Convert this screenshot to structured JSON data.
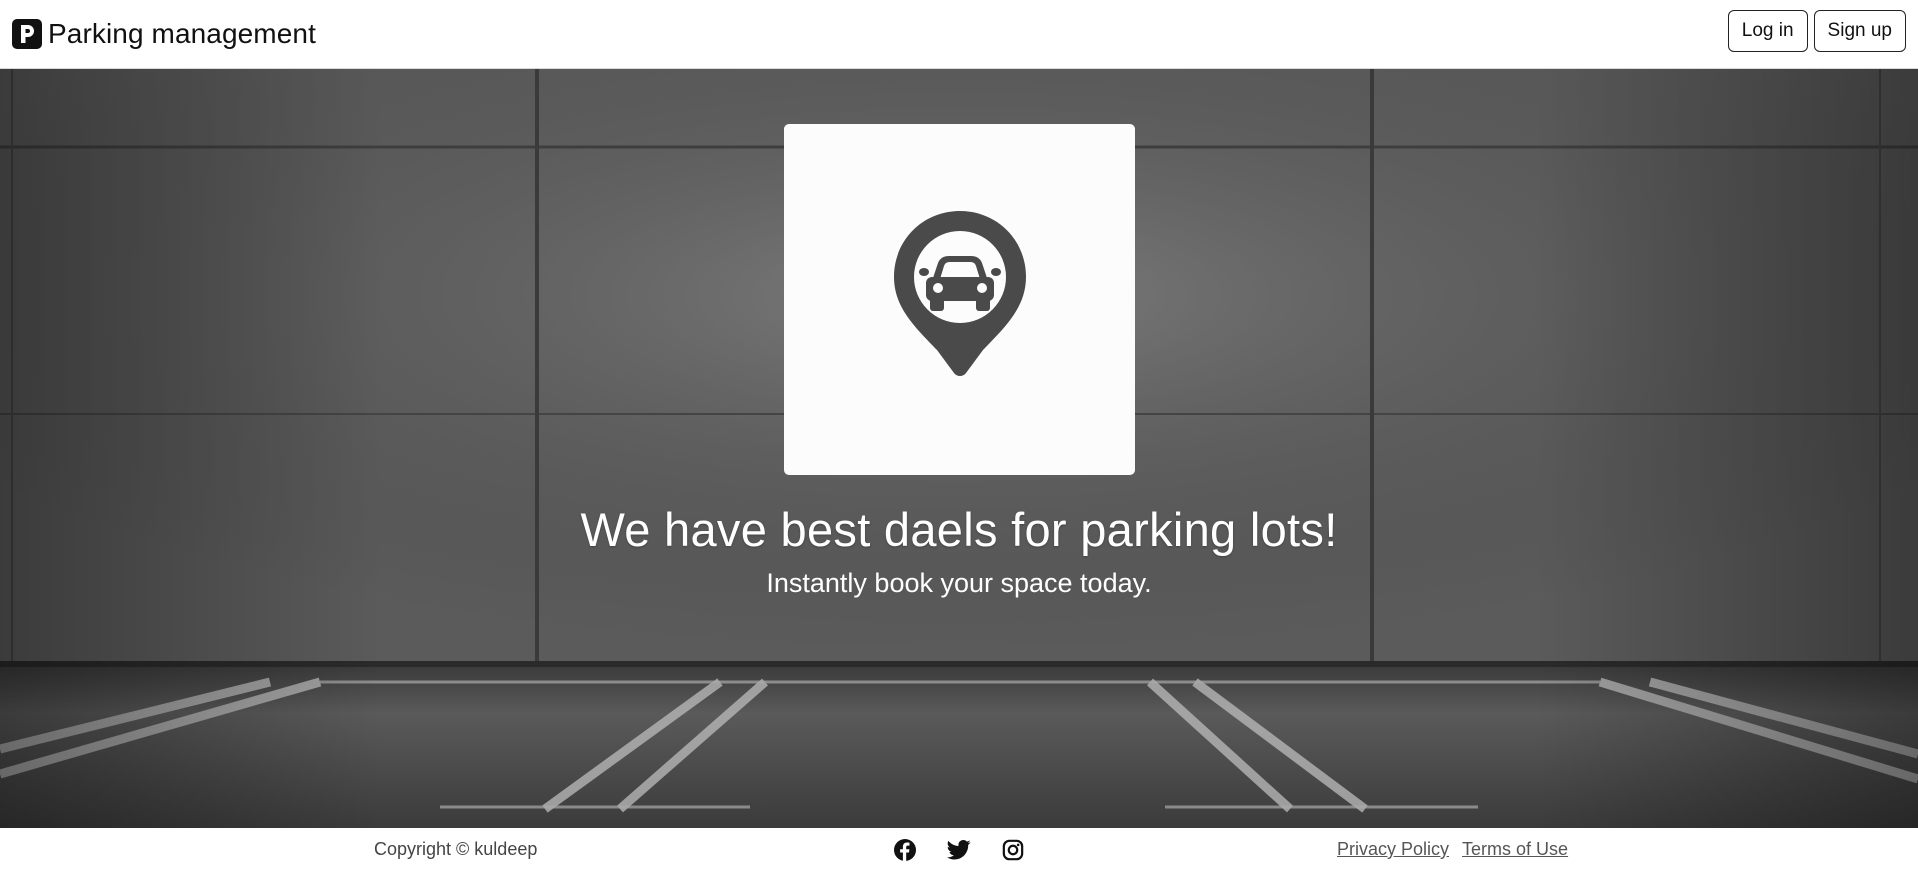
{
  "header": {
    "brand_icon": "parking-p-icon",
    "title": "Parking management",
    "login_label": "Log in",
    "signup_label": "Sign up"
  },
  "hero": {
    "logo_icon": "car-location-pin-icon",
    "headline": "We have best daels for parking lots!",
    "subtitle": "Instantly book your space today."
  },
  "footer": {
    "copyright": "Copyright © kuldeep",
    "socials": [
      {
        "icon": "facebook-icon"
      },
      {
        "icon": "twitter-icon"
      },
      {
        "icon": "instagram-icon"
      }
    ],
    "links": {
      "privacy": "Privacy Policy",
      "terms": "Terms of Use"
    }
  },
  "colors": {
    "brand_dark": "#111111",
    "logo_gray": "#4a4a4a",
    "hero_text": "#ffffff",
    "footer_text": "#444444"
  }
}
